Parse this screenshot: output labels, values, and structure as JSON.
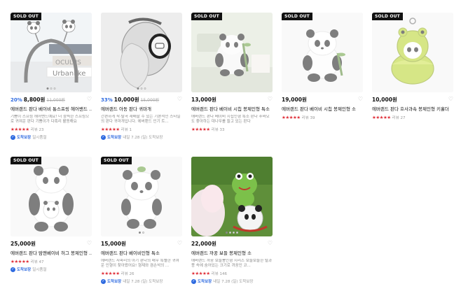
{
  "sold_out_label": "SOLD OUT",
  "products": [
    {
      "sold_out": true,
      "discount": "20%",
      "price": "8,800원",
      "orig": "11,000원",
      "name": "에버랜드 판다 베이비 통스프링 헤어밴드 ...",
      "desc": "기쁨이 스프링 헤어밴드예요! 더 깜찍한 스프링으로 귀여운 판다 기쁨이가 다흑리 활동해요",
      "stars": "★★★★★",
      "reviews": "리뷰 23",
      "tag_main": "도착보장",
      "tag_sub": "일시품절",
      "image": "headband"
    },
    {
      "sold_out": false,
      "discount": "33%",
      "price": "10,000원",
      "orig": "15,000원",
      "name": "에버랜드 아동 판다 귀마개",
      "desc": "간편하게 착·탈곡 재배할 수 있는 기본적인 스타일의 판다 귀마개입니다. 에버랜드 인기 트...",
      "stars": "★★★★★",
      "reviews": "리뷰 1",
      "tag_main": "도착보장",
      "tag_sub": "내일 7.28 (일) 도착보장",
      "image": "earmuff"
    },
    {
      "sold_out": true,
      "discount": "",
      "price": "13,000원",
      "orig": "",
      "name": "에버랜드 판다 베이비 시칩 봉제인형 특소",
      "desc": "에버랜드 판다 베이비 시칩인형 특소 판다 푸바오도 좋아하는 대나무를 들고 있는 판다",
      "stars": "★★★★★",
      "reviews": "리뷰 33",
      "tag_main": "",
      "tag_sub": "",
      "image": "panda-bamboo-room"
    },
    {
      "sold_out": true,
      "discount": "",
      "price": "19,000원",
      "orig": "",
      "name": "에버랜드 판다 베이비 시칩 봉제인형 소",
      "desc": "",
      "stars": "★★★★★",
      "reviews": "리뷰 39",
      "tag_main": "",
      "tag_sub": "",
      "image": "panda-bamboo"
    },
    {
      "sold_out": true,
      "discount": "",
      "price": "10,000원",
      "orig": "",
      "name": "에버랜드 판다 호사과속 봉제인형 키홀더",
      "desc": "",
      "stars": "★★★★★",
      "reviews": "리뷰 27",
      "tag_main": "",
      "tag_sub": "",
      "image": "panda-frog-pod"
    },
    {
      "sold_out": true,
      "discount": "",
      "price": "25,000원",
      "orig": "",
      "name": "에버랜드 판다 맘앤베이비 허그 봉제인형 ...",
      "desc": "",
      "stars": "★★★★★",
      "reviews": "리뷰 47",
      "tag_main": "도착보장",
      "tag_sub": "일시품절",
      "image": "panda-mom-baby"
    },
    {
      "sold_out": true,
      "discount": "",
      "price": "15,000원",
      "orig": "",
      "name": "에버랜드 판다 베이비인형 특소",
      "desc": "에버랜드 사파리의 아기 판다의 매우 특별한 귀여운 인형이 찾아왔어요! 형제와 겸손석의 ...",
      "stars": "★★★★★",
      "reviews": "리뷰 26",
      "tag_main": "도착보장",
      "tag_sub": "내일 7.28 (일) 도착보장",
      "image": "panda-baby-sit"
    },
    {
      "sold_out": false,
      "discount": "",
      "price": "22,000원",
      "orig": "",
      "name": "에버랜드 까꿍 보들 봉제인형 소",
      "desc": "에버랜드 까꿍 보들봉인형 시리즈 보들보들한 털과 몽 속에 숨어있는 크기로 까꿍인 코...",
      "stars": "★★★★★",
      "reviews": "리뷰 146",
      "tag_main": "도착보장",
      "tag_sub": "내일 7.28 (일) 도착보장",
      "image": "kkakkung-plush"
    }
  ]
}
